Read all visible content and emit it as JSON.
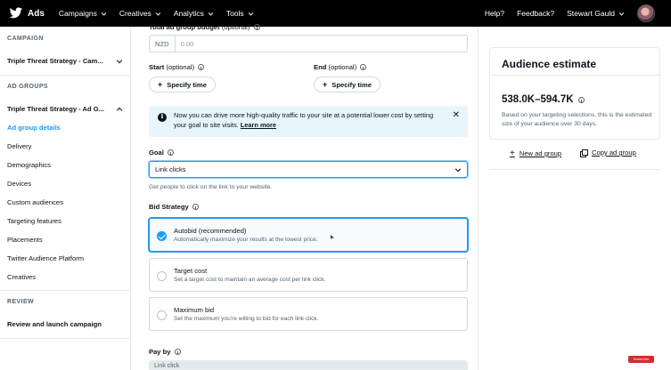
{
  "topbar": {
    "logo_text": "Ads",
    "nav": [
      "Campaigns",
      "Creatives",
      "Analytics",
      "Tools"
    ],
    "help": "Help?",
    "feedback": "Feedback?",
    "user": "Stewart Gauld"
  },
  "sidebar": {
    "campaign_heading": "CAMPAIGN",
    "campaign_name": "Triple Threat Strategy - Cam...",
    "ad_groups_heading": "AD GROUPS",
    "ad_group_name": "Triple Threat Strategy - Ad G...",
    "links": [
      "Ad group details",
      "Delivery",
      "Demographics",
      "Devices",
      "Custom audiences",
      "Targeting features",
      "Placements",
      "Twitter Audience Platform",
      "Creatives"
    ],
    "review_heading": "REVIEW",
    "review_link": "Review and launch campaign"
  },
  "main": {
    "budget_label": "Total ad group budget",
    "budget_optional": "(optional)",
    "currency": "NZD",
    "budget_placeholder": "0.00",
    "start_label": "Start",
    "start_optional": "(optional)",
    "end_label": "End",
    "end_optional": "(optional)",
    "specify_time": "Specify time",
    "banner_text": "Now you can drive more high-quality traffic to your site at a potential lower cost by setting your goal to site visits.",
    "banner_link": "Learn more",
    "goal_label": "Goal",
    "goal_value": "Link clicks",
    "goal_help": "Get people to click on the link to your website.",
    "bid_label": "Bid Strategy",
    "bid_options": [
      {
        "title": "Autobid (recommended)",
        "desc": "Automatically maximize your results at the lowest price."
      },
      {
        "title": "Target cost",
        "desc": "Set a target cost to maintain an average cost per link click."
      },
      {
        "title": "Maximum bid",
        "desc": "Set the maximum you're willing to bid for each link click."
      }
    ],
    "pay_by_label": "Pay by",
    "pay_by_value": "Link click"
  },
  "estimate": {
    "title": "Audience estimate",
    "range": "538.0K–594.7K",
    "desc": "Based on your targeting selections, this is the estimated size of your audience over 30 days.",
    "new_ad_group": "New ad group",
    "copy_ad_group": "Copy ad group"
  },
  "badge": "Subscribe"
}
